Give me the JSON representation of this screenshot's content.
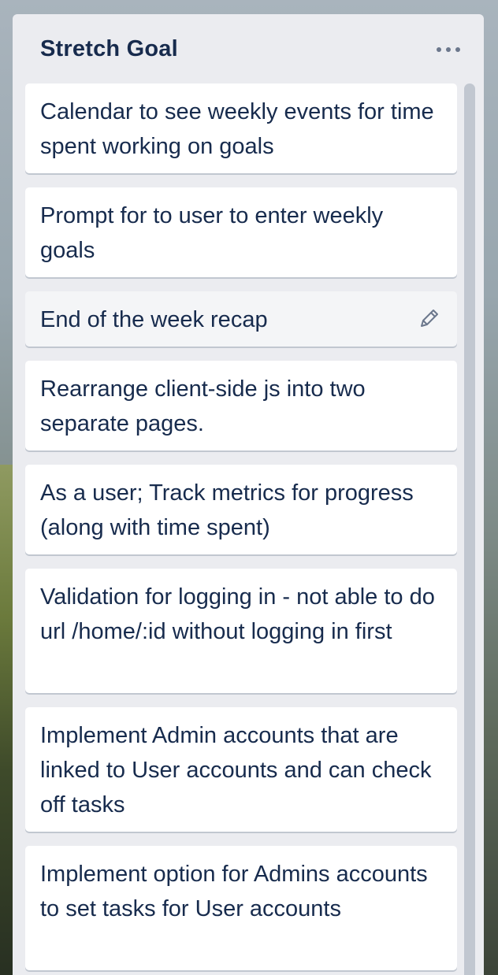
{
  "list": {
    "title": "Stretch Goal",
    "menu_icon": "more-horizontal-icon",
    "cards": [
      {
        "text": "Calendar to see weekly events for time spent working on goals"
      },
      {
        "text": "Prompt for to user to enter weekly goals"
      },
      {
        "text": "End of the week recap",
        "edit_icon": "pencil-icon"
      },
      {
        "text": "Rearrange client-side js into two separate pages."
      },
      {
        "text": "As a user; Track metrics for progress (along with time spent)"
      },
      {
        "text": "Validation for logging in - not able to do url /home/:id without logging in first"
      },
      {
        "text": "Implement Admin accounts that are linked to User accounts and can check off tasks"
      },
      {
        "text": "Implement option for Admins accounts to set tasks for User accounts"
      }
    ]
  },
  "colors": {
    "list_bg": "#ebecf0",
    "card_bg": "#ffffff",
    "text": "#172b4d",
    "muted": "#6b778c"
  }
}
